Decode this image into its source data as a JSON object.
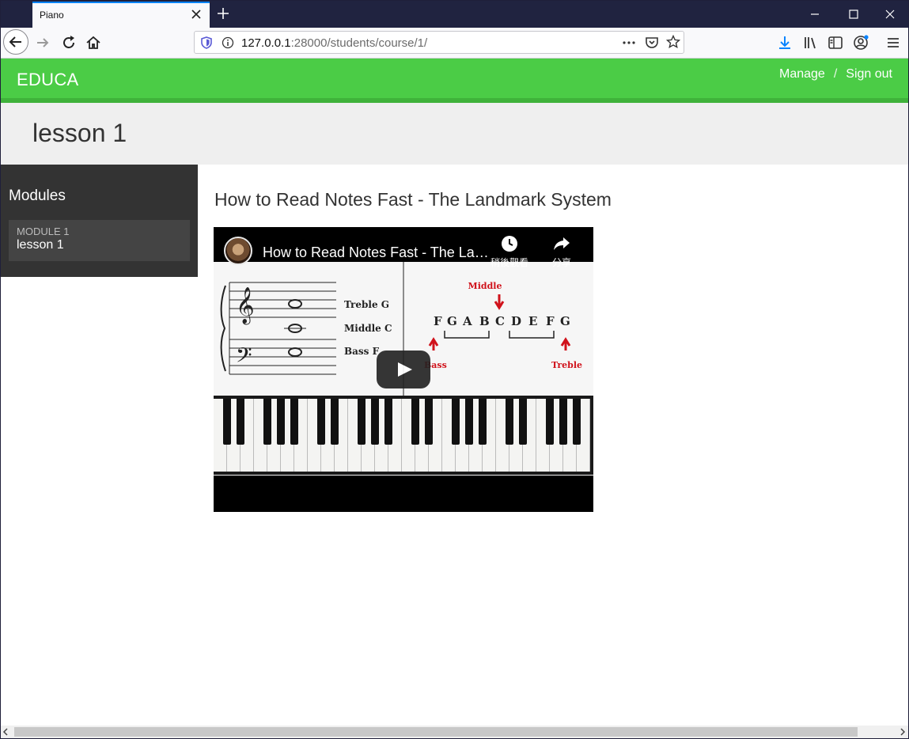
{
  "browser": {
    "tab_title": "Piano",
    "url_host": "127.0.0.1",
    "url_rest": ":28000/students/course/1/"
  },
  "site": {
    "logo": "EDUCA",
    "nav": {
      "manage": "Manage",
      "separator": "/",
      "sign_out": "Sign out"
    },
    "accent_color": "#4bcc46"
  },
  "page": {
    "title": "lesson 1"
  },
  "sidebar": {
    "heading": "Modules",
    "modules": [
      {
        "label": "Module 1",
        "lesson": "lesson 1"
      }
    ]
  },
  "content": {
    "title": "How to Read Notes Fast - The Landmark System",
    "video": {
      "title": "How to Read Notes Fast - The La…",
      "watch_later_label": "稍後觀看",
      "share_label": "分享",
      "staff_labels": [
        "Treble G",
        "Middle C",
        "Bass F"
      ],
      "diagram_top_label": "Middle",
      "notes": [
        "F",
        "G",
        "A",
        "B",
        "C",
        "D",
        "E",
        "F",
        "G"
      ],
      "bass_label": "Bass",
      "treble_label": "Treble"
    }
  }
}
